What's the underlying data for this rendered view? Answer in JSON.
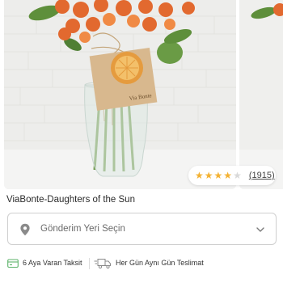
{
  "product": {
    "title": "ViaBonte-Daughters of the Sun",
    "tag_text": "Via Bonte"
  },
  "rating": {
    "value": 4,
    "max": 5,
    "count_label": "(1915)",
    "star_color": "#f4b233"
  },
  "delivery": {
    "placeholder": "Gönderim Yeri Seçin",
    "location_icon": "map-pin-icon",
    "dropdown_icon": "chevron-down-icon"
  },
  "features": [
    {
      "icon": "installment-card-icon",
      "label": "6 Aya Varan Taksit"
    },
    {
      "icon": "delivery-truck-icon",
      "label": "Her Gün Aynı Gün Teslimat"
    }
  ],
  "colors": {
    "accent_green": "#5db36a",
    "text_dark": "#2b2b2b",
    "border": "#cfcfcf"
  }
}
